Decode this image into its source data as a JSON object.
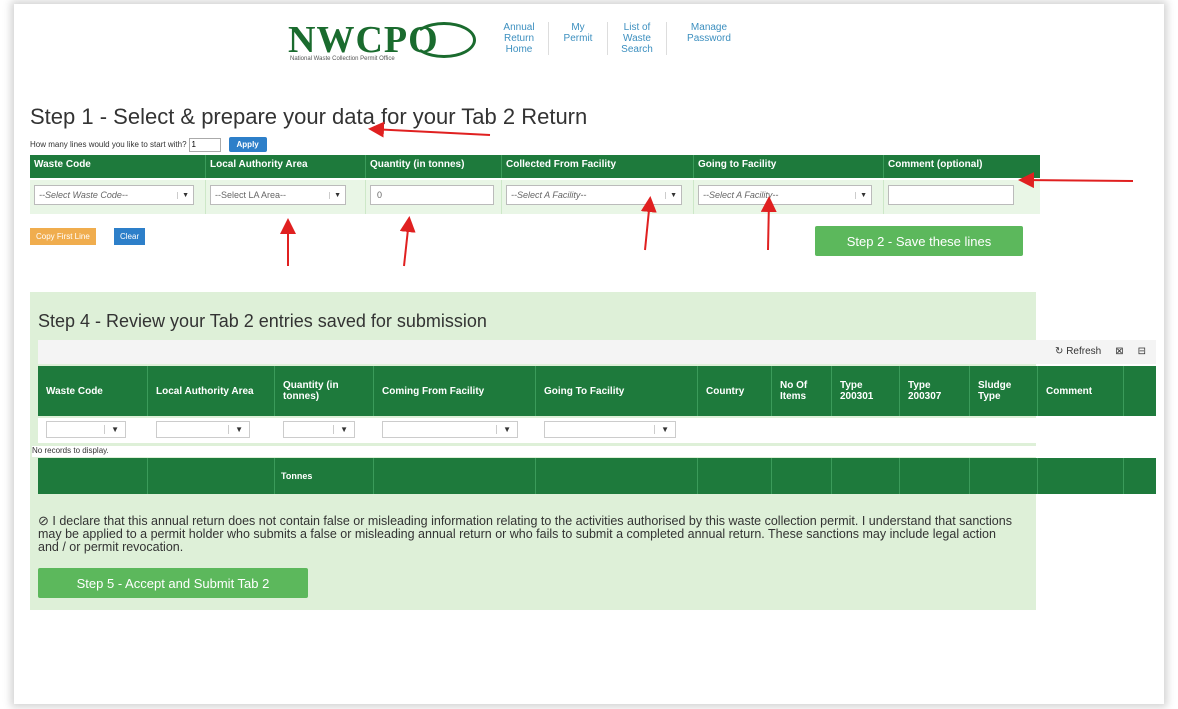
{
  "logo": {
    "text": "NWCPO",
    "subtitle": "National Waste Collection Permit Office"
  },
  "nav": [
    "Annual Return Home",
    "My Permit",
    "List of Waste Search",
    "Manage Password"
  ],
  "step1": {
    "title": "Step 1 -  Select & prepare your data for your Tab 2 Return",
    "lines_prompt": "How many lines would you like to start with?",
    "lines_value": "1",
    "apply_label": "Apply",
    "headers": [
      "Waste Code",
      "Local Authority Area",
      "Quantity (in tonnes)",
      "Collected From Facility",
      "Going to Facility",
      "Comment (optional)"
    ],
    "waste_code_select": "--Select Waste Code--",
    "la_select": "--Select LA Area--",
    "quantity_value": "0",
    "collected_select": "--Select A Facility--",
    "going_select": "--Select A Facility--",
    "comment_value": "",
    "copy_label": "Copy First Line",
    "clear_label": "Clear",
    "save_label": "Step 2 - Save these lines"
  },
  "step4": {
    "title": "Step 4 - Review your Tab 2 entries saved for submission",
    "refresh_label": "Refresh",
    "headers": [
      "Waste Code",
      "Local Authority Area",
      "Quantity (in tonnes)",
      "Coming From Facility",
      "Going To Facility",
      "Country",
      "No Of Items",
      "Type 200301",
      "Type 200307",
      "Sludge Type",
      "Comment"
    ],
    "no_records": "No records to display.",
    "footer_tonnes": "Tonnes"
  },
  "declaration": "I declare that this annual return does not contain false or misleading information relating to the activities authorised by this waste collection permit. I understand that sanctions may be applied to a permit holder who submits a false or misleading annual return or who fails to submit a completed annual return. These sanctions may include legal action and / or permit revocation.",
  "submit_label": "Step 5 - Accept and Submit Tab 2",
  "colors": {
    "green_header": "#1e7a3c",
    "green_button": "#5cb85c",
    "panel": "#def0d8",
    "blue": "#2d7fc9",
    "orange": "#f0ad4e",
    "annotation_arrow": "#e02020"
  }
}
